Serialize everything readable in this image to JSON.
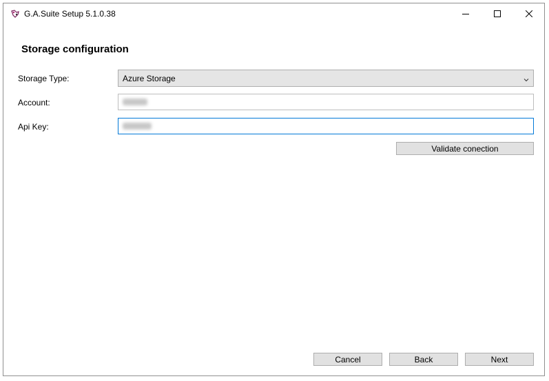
{
  "window": {
    "title": "G.A.Suite Setup 5.1.0.38",
    "app_icon": "ga-suite-app-icon",
    "controls": [
      "minimize-icon",
      "maximize-icon",
      "close-icon"
    ]
  },
  "page": {
    "heading": "Storage configuration"
  },
  "form": {
    "storage_type_label": "Storage Type:",
    "storage_type_value": "Azure Storage",
    "account_label": "Account:",
    "api_key_label": "Api Key:"
  },
  "buttons": {
    "validate": "Validate conection",
    "cancel": "Cancel",
    "back": "Back",
    "next": "Next"
  },
  "colors": {
    "focus_border": "#0078d7",
    "button_face": "#e1e1e1"
  }
}
